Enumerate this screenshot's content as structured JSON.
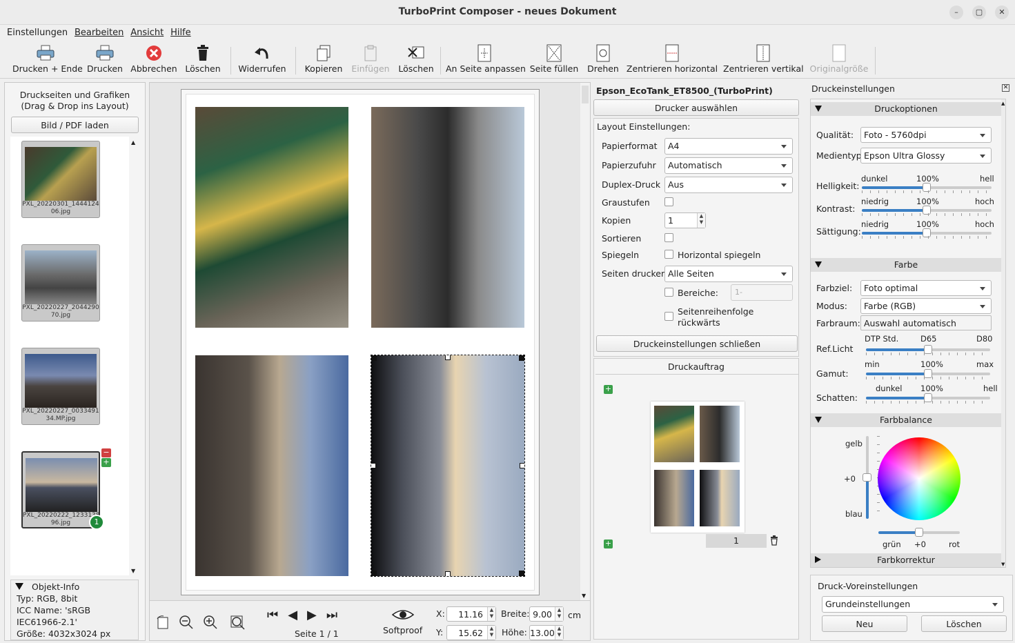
{
  "window": {
    "title": "TurboPrint Composer - neues Dokument",
    "min": "–",
    "max": "▢",
    "close": "✕"
  },
  "menu": [
    "Einstellungen",
    "Bearbeiten",
    "Ansicht",
    "Hilfe"
  ],
  "toolbar": {
    "print_exit": "Drucken + Ende",
    "print": "Drucken",
    "cancel": "Abbrechen",
    "delete": "Löschen",
    "undo": "Widerrufen",
    "copy": "Kopieren",
    "paste": "Einfügen",
    "delete2": "Löschen",
    "fit_page": "An Seite anpassen",
    "fill_page": "Seite füllen",
    "rotate": "Drehen",
    "center_h": "Zentrieren horizontal",
    "center_v": "Zentrieren vertikal",
    "original_size": "Originalgröße"
  },
  "left": {
    "heading1": "Druckseiten und Grafiken",
    "heading2": "(Drag & Drop ins Layout)",
    "load_button": "Bild / PDF laden",
    "thumbs": [
      {
        "name1": "PXL_20220301_1444124",
        "name2": "06.jpg"
      },
      {
        "name1": "PXL_20220227_2044290",
        "name2": "70.jpg"
      },
      {
        "name1": "PXL_20220227_0033491",
        "name2": "34.MP.jpg"
      },
      {
        "name1": "PXL_20220222_1233138",
        "name2": "96.jpg",
        "badge": "1"
      }
    ],
    "info_title": "Objekt-Info",
    "info_type": "Typ: RGB, 8bit",
    "info_icc1": "ICC Name: 'sRGB",
    "info_icc2": "IEC61966-2.1'",
    "info_size": "Größe: 4032x3024 px"
  },
  "bottom": {
    "page": "Seite 1 / 1",
    "softproof": "Softproof",
    "x_label": "X:",
    "x": "11.16",
    "y_label": "Y:",
    "y": "15.62",
    "w_label": "Breite:",
    "w": "9.00",
    "h_label": "Höhe:",
    "h": "13.00",
    "unit": "cm"
  },
  "printer": {
    "name": "Epson_EcoTank_ET8500_(TurboPrint)",
    "select": "Drucker auswählen",
    "layout_title": "Layout Einstellungen:",
    "paper_label": "Papierformat",
    "paper": "A4",
    "feed_label": "Papierzufuhr",
    "feed": "Automatisch",
    "duplex_label": "Duplex-Druck",
    "duplex": "Aus",
    "gray_label": "Graustufen",
    "copies_label": "Kopien",
    "copies": "1",
    "sort_label": "Sortieren",
    "mirror_label": "Spiegeln",
    "mirror_h": "Horizontal spiegeln",
    "pages_label": "Seiten drucken:",
    "pages": "Alle Seiten",
    "ranges": "Bereiche:",
    "ranges_ph": "1-",
    "reverse1": "Seitenreihenfolge",
    "reverse2": "rückwärts",
    "close_btn": "Druckeinstellungen schließen",
    "job_title": "Druckauftrag",
    "job_count": "1"
  },
  "settings": {
    "title": "Druckeinstellungen",
    "options": "Druckoptionen",
    "quality_label": "Qualität:",
    "quality": "Foto - 5760dpi",
    "media_label": "Medientyp:",
    "media": "Epson Ultra Glossy",
    "brightness": {
      "label": "Helligkeit:",
      "min": "dunkel",
      "mid": "100%",
      "max": "hell"
    },
    "contrast": {
      "label": "Kontrast:",
      "min": "niedrig",
      "mid": "100%",
      "max": "hoch"
    },
    "saturation": {
      "label": "Sättigung:",
      "min": "niedrig",
      "mid": "100%",
      "max": "hoch"
    },
    "color": "Farbe",
    "target_label": "Farbziel:",
    "target": "Foto optimal",
    "mode_label": "Modus:",
    "mode": "Farbe (RGB)",
    "space_label": "Farbraum:",
    "space": "Auswahl automatisch",
    "reflight": {
      "label": "Ref.Licht",
      "min": "DTP Std.",
      "mid": "D65",
      "max": "D80"
    },
    "gamut": {
      "label": "Gamut:",
      "min": "min",
      "mid": "100%",
      "max": "max"
    },
    "shadow": {
      "label": "Schatten:",
      "min": "dunkel",
      "mid": "100%",
      "max": "hell"
    },
    "balance": "Farbbalance",
    "yellow": "gelb",
    "plus0": "+0",
    "blue": "blau",
    "green": "grün",
    "plus0b": "+0",
    "red": "rot",
    "correction": "Farbkorrektur",
    "presets_title": "Druck-Voreinstellungen",
    "preset": "Grundeinstellungen",
    "new": "Neu",
    "delete": "Löschen"
  }
}
